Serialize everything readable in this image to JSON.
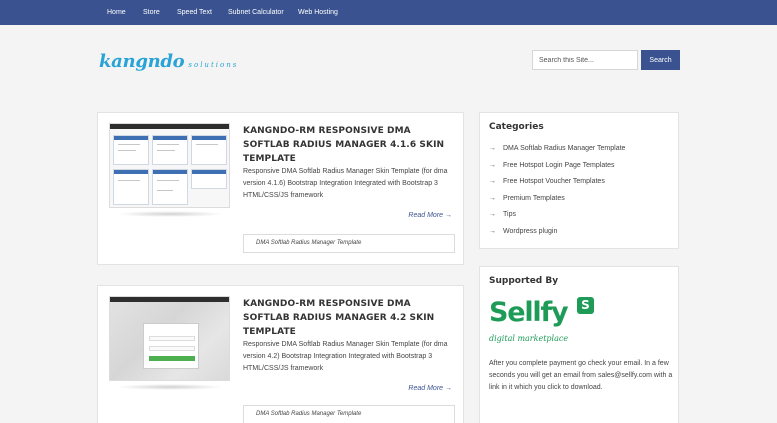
{
  "nav": {
    "items": [
      {
        "label": "Home"
      },
      {
        "label": "Store"
      },
      {
        "label": "Speed Text"
      },
      {
        "label": "Subnet Calculator"
      },
      {
        "label": "Web Hosting"
      }
    ]
  },
  "logo": {
    "main": "kangndo",
    "sub": "solutions"
  },
  "search": {
    "placeholder": "Search this Site...",
    "button_label": "Search"
  },
  "posts": [
    {
      "title": "KANGNDO-RM RESPONSIVE DMA SOFTLAB RADIUS MANAGER 4.1.6 SKIN TEMPLATE",
      "excerpt": "Responsive DMA Softlab Radius Manager Skin Template (for dma version 4.1.6) Bootstrap Integration Integrated with Bootstrap 3 HTML/CSS/JS framework",
      "read_more": "Read More →",
      "category": "DMA Softlab Radius Manager Template"
    },
    {
      "title": "KANGNDO-RM RESPONSIVE DMA SOFTLAB RADIUS MANAGER 4.2 SKIN TEMPLATE",
      "excerpt": "Responsive DMA Softlab Radius Manager Skin Template (for dma version 4.2) Bootstrap Integration Integrated with Bootstrap 3 HTML/CSS/JS framework",
      "read_more": "Read More →",
      "category": "DMA Softlab Radius Manager Template"
    }
  ],
  "categories": {
    "title": "Categories",
    "items": [
      {
        "label": "DMA Softlab Radius Manager Template"
      },
      {
        "label": "Free Hotspot Login Page Templates"
      },
      {
        "label": "Free Hotspot Voucher Templates"
      },
      {
        "label": "Premium Templates"
      },
      {
        "label": "Tips"
      },
      {
        "label": "Wordpress plugin"
      }
    ]
  },
  "sellfy": {
    "title": "Supported By",
    "brand": "Sellfy",
    "badge": "S",
    "tagline": "digital marketplace",
    "note": "After you complete payment go check your email. In a few seconds you will get an email from sales@sellfy.com with a link in it which you click to download."
  },
  "icons": {
    "arrow": "→"
  },
  "colors": {
    "nav_bg": "#3a5390",
    "logo": "#2aa3d6",
    "sellfy_green": "#1e9b57"
  }
}
